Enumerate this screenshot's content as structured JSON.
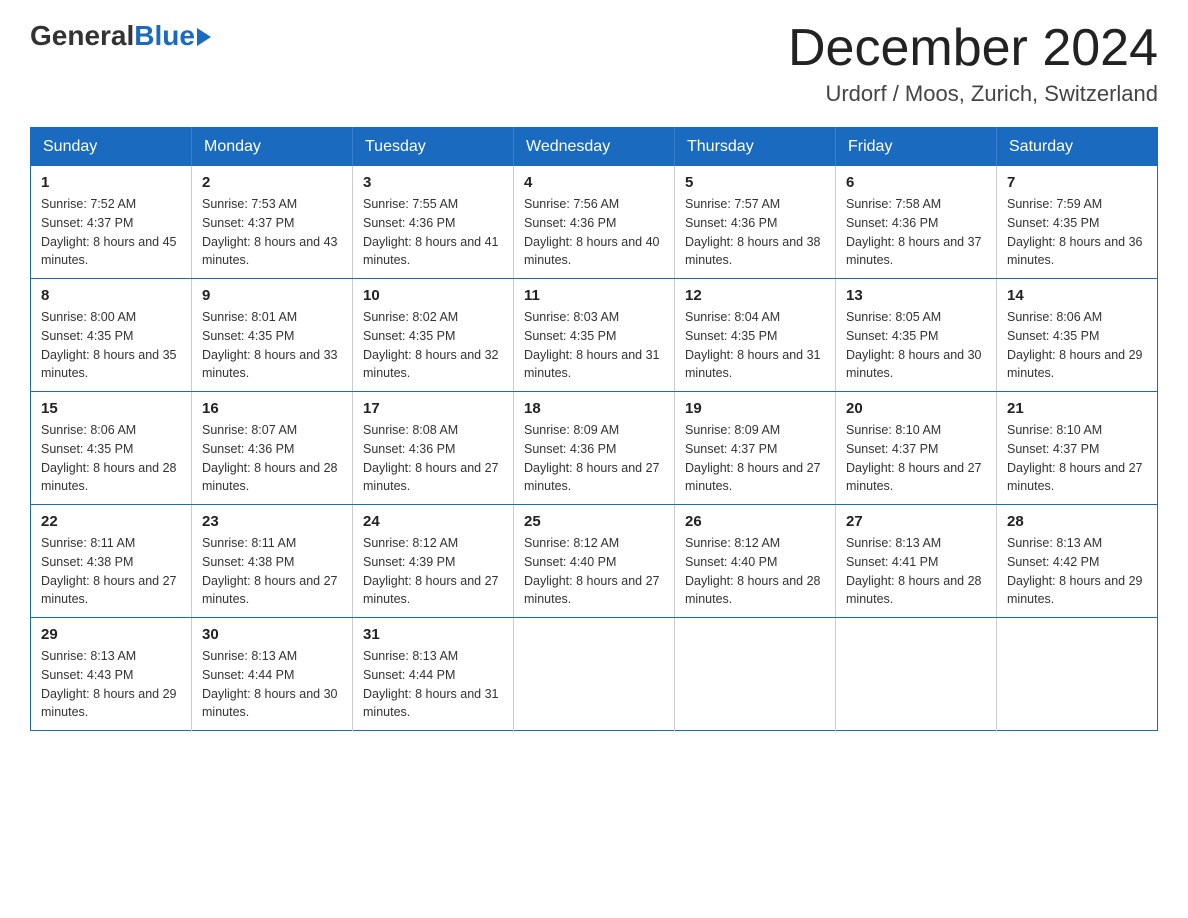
{
  "logo": {
    "general": "General",
    "blue": "Blue"
  },
  "title": "December 2024",
  "subtitle": "Urdorf / Moos, Zurich, Switzerland",
  "days_of_week": [
    "Sunday",
    "Monday",
    "Tuesday",
    "Wednesday",
    "Thursday",
    "Friday",
    "Saturday"
  ],
  "weeks": [
    [
      {
        "day": "1",
        "sunrise": "7:52 AM",
        "sunset": "4:37 PM",
        "daylight": "8 hours and 45 minutes."
      },
      {
        "day": "2",
        "sunrise": "7:53 AM",
        "sunset": "4:37 PM",
        "daylight": "8 hours and 43 minutes."
      },
      {
        "day": "3",
        "sunrise": "7:55 AM",
        "sunset": "4:36 PM",
        "daylight": "8 hours and 41 minutes."
      },
      {
        "day": "4",
        "sunrise": "7:56 AM",
        "sunset": "4:36 PM",
        "daylight": "8 hours and 40 minutes."
      },
      {
        "day": "5",
        "sunrise": "7:57 AM",
        "sunset": "4:36 PM",
        "daylight": "8 hours and 38 minutes."
      },
      {
        "day": "6",
        "sunrise": "7:58 AM",
        "sunset": "4:36 PM",
        "daylight": "8 hours and 37 minutes."
      },
      {
        "day": "7",
        "sunrise": "7:59 AM",
        "sunset": "4:35 PM",
        "daylight": "8 hours and 36 minutes."
      }
    ],
    [
      {
        "day": "8",
        "sunrise": "8:00 AM",
        "sunset": "4:35 PM",
        "daylight": "8 hours and 35 minutes."
      },
      {
        "day": "9",
        "sunrise": "8:01 AM",
        "sunset": "4:35 PM",
        "daylight": "8 hours and 33 minutes."
      },
      {
        "day": "10",
        "sunrise": "8:02 AM",
        "sunset": "4:35 PM",
        "daylight": "8 hours and 32 minutes."
      },
      {
        "day": "11",
        "sunrise": "8:03 AM",
        "sunset": "4:35 PM",
        "daylight": "8 hours and 31 minutes."
      },
      {
        "day": "12",
        "sunrise": "8:04 AM",
        "sunset": "4:35 PM",
        "daylight": "8 hours and 31 minutes."
      },
      {
        "day": "13",
        "sunrise": "8:05 AM",
        "sunset": "4:35 PM",
        "daylight": "8 hours and 30 minutes."
      },
      {
        "day": "14",
        "sunrise": "8:06 AM",
        "sunset": "4:35 PM",
        "daylight": "8 hours and 29 minutes."
      }
    ],
    [
      {
        "day": "15",
        "sunrise": "8:06 AM",
        "sunset": "4:35 PM",
        "daylight": "8 hours and 28 minutes."
      },
      {
        "day": "16",
        "sunrise": "8:07 AM",
        "sunset": "4:36 PM",
        "daylight": "8 hours and 28 minutes."
      },
      {
        "day": "17",
        "sunrise": "8:08 AM",
        "sunset": "4:36 PM",
        "daylight": "8 hours and 27 minutes."
      },
      {
        "day": "18",
        "sunrise": "8:09 AM",
        "sunset": "4:36 PM",
        "daylight": "8 hours and 27 minutes."
      },
      {
        "day": "19",
        "sunrise": "8:09 AM",
        "sunset": "4:37 PM",
        "daylight": "8 hours and 27 minutes."
      },
      {
        "day": "20",
        "sunrise": "8:10 AM",
        "sunset": "4:37 PM",
        "daylight": "8 hours and 27 minutes."
      },
      {
        "day": "21",
        "sunrise": "8:10 AM",
        "sunset": "4:37 PM",
        "daylight": "8 hours and 27 minutes."
      }
    ],
    [
      {
        "day": "22",
        "sunrise": "8:11 AM",
        "sunset": "4:38 PM",
        "daylight": "8 hours and 27 minutes."
      },
      {
        "day": "23",
        "sunrise": "8:11 AM",
        "sunset": "4:38 PM",
        "daylight": "8 hours and 27 minutes."
      },
      {
        "day": "24",
        "sunrise": "8:12 AM",
        "sunset": "4:39 PM",
        "daylight": "8 hours and 27 minutes."
      },
      {
        "day": "25",
        "sunrise": "8:12 AM",
        "sunset": "4:40 PM",
        "daylight": "8 hours and 27 minutes."
      },
      {
        "day": "26",
        "sunrise": "8:12 AM",
        "sunset": "4:40 PM",
        "daylight": "8 hours and 28 minutes."
      },
      {
        "day": "27",
        "sunrise": "8:13 AM",
        "sunset": "4:41 PM",
        "daylight": "8 hours and 28 minutes."
      },
      {
        "day": "28",
        "sunrise": "8:13 AM",
        "sunset": "4:42 PM",
        "daylight": "8 hours and 29 minutes."
      }
    ],
    [
      {
        "day": "29",
        "sunrise": "8:13 AM",
        "sunset": "4:43 PM",
        "daylight": "8 hours and 29 minutes."
      },
      {
        "day": "30",
        "sunrise": "8:13 AM",
        "sunset": "4:44 PM",
        "daylight": "8 hours and 30 minutes."
      },
      {
        "day": "31",
        "sunrise": "8:13 AM",
        "sunset": "4:44 PM",
        "daylight": "8 hours and 31 minutes."
      },
      null,
      null,
      null,
      null
    ]
  ]
}
